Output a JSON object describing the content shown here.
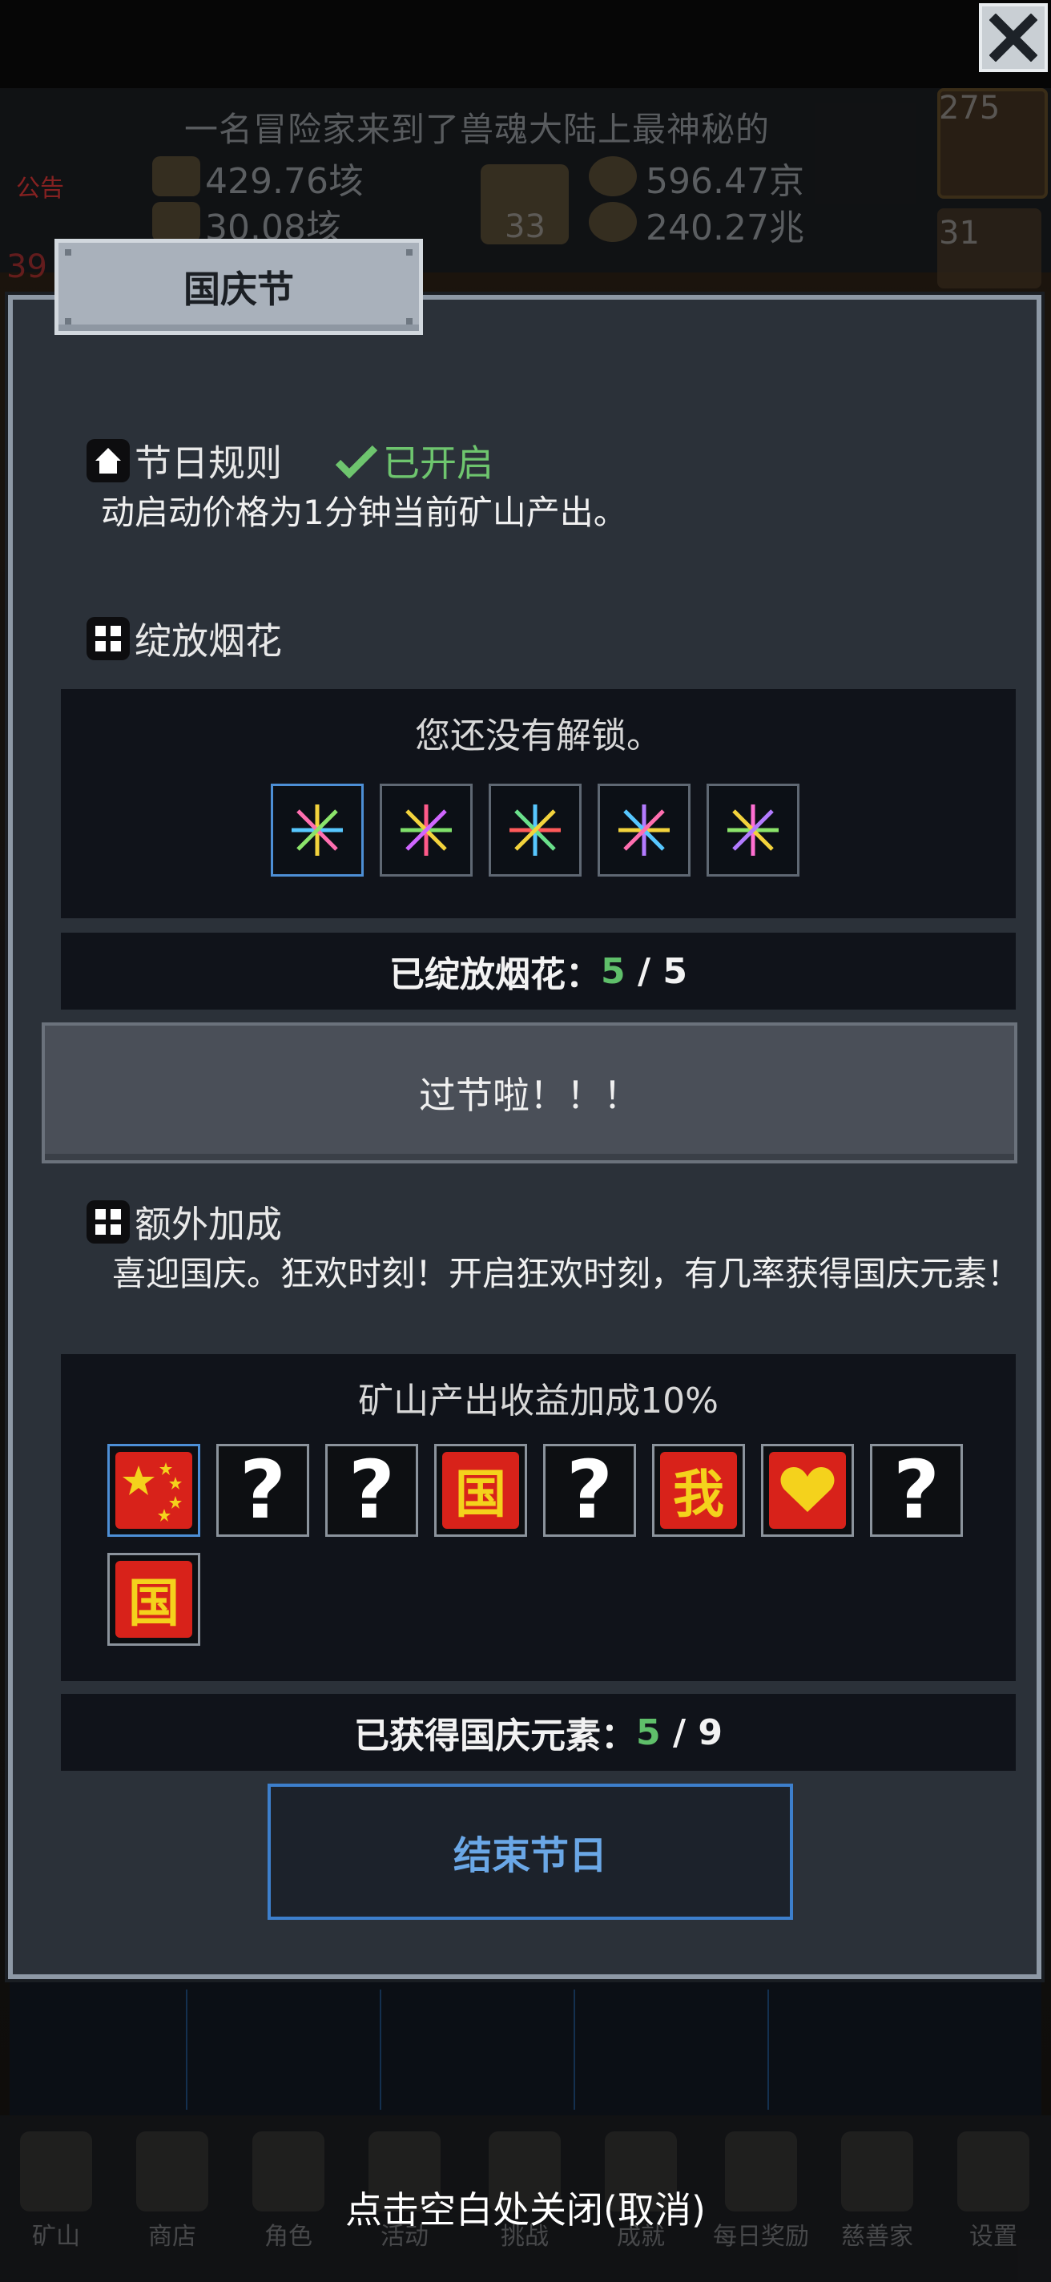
{
  "background": {
    "ticker": "一名冒险家来到了兽魂大陆上最神秘的",
    "notice_badge": "公告",
    "resources": [
      {
        "value": "429.76垓"
      },
      {
        "value": "596.47京"
      },
      {
        "value": "30.08垓"
      },
      {
        "value": "240.27兆"
      }
    ],
    "counts": [
      "275",
      "33",
      "31",
      "39"
    ],
    "nav": [
      "矿山",
      "商店",
      "角色",
      "活动",
      "挑战",
      "成就",
      "每日奖励",
      "慈善家",
      "设置"
    ]
  },
  "dialog": {
    "title": "国庆节",
    "rules": {
      "heading": "节日规则",
      "status": "已开启",
      "text": "动启动价格为1分钟当前矿山产出。"
    },
    "fireworks": {
      "heading": "绽放烟花",
      "locked_text": "您还没有解锁。",
      "count_label": "已绽放烟花：",
      "count_current": "5",
      "count_sep": " / ",
      "count_total": "5",
      "action_button": "过节啦！！！"
    },
    "bonus": {
      "heading": "额外加成",
      "text": "喜迎国庆。狂欢时刻！开启狂欢时刻，有几率获得国庆元素！",
      "panel_text": "矿山产出收益加成10%",
      "elements": [
        {
          "kind": "flag",
          "icon": "china-flag-icon"
        },
        {
          "kind": "unknown",
          "glyph": "?"
        },
        {
          "kind": "unknown",
          "glyph": "?"
        },
        {
          "kind": "char",
          "glyph": "国"
        },
        {
          "kind": "unknown",
          "glyph": "?"
        },
        {
          "kind": "char",
          "glyph": "我"
        },
        {
          "kind": "heart",
          "icon": "heart-icon"
        },
        {
          "kind": "unknown",
          "glyph": "?"
        },
        {
          "kind": "char",
          "glyph": "国"
        }
      ],
      "count_label": "已获得国庆元素：",
      "count_current": "5",
      "count_sep": " / ",
      "count_total": "9"
    },
    "end_button": "结束节日"
  },
  "close_hint": "点击空白处关闭(取消)",
  "colors": {
    "accent_green": "#5fbf6a",
    "accent_blue": "#3d7fcc",
    "dialog_bg": "#2b3139",
    "flag_red": "#d8221a",
    "flag_yellow": "#f4d21c"
  }
}
